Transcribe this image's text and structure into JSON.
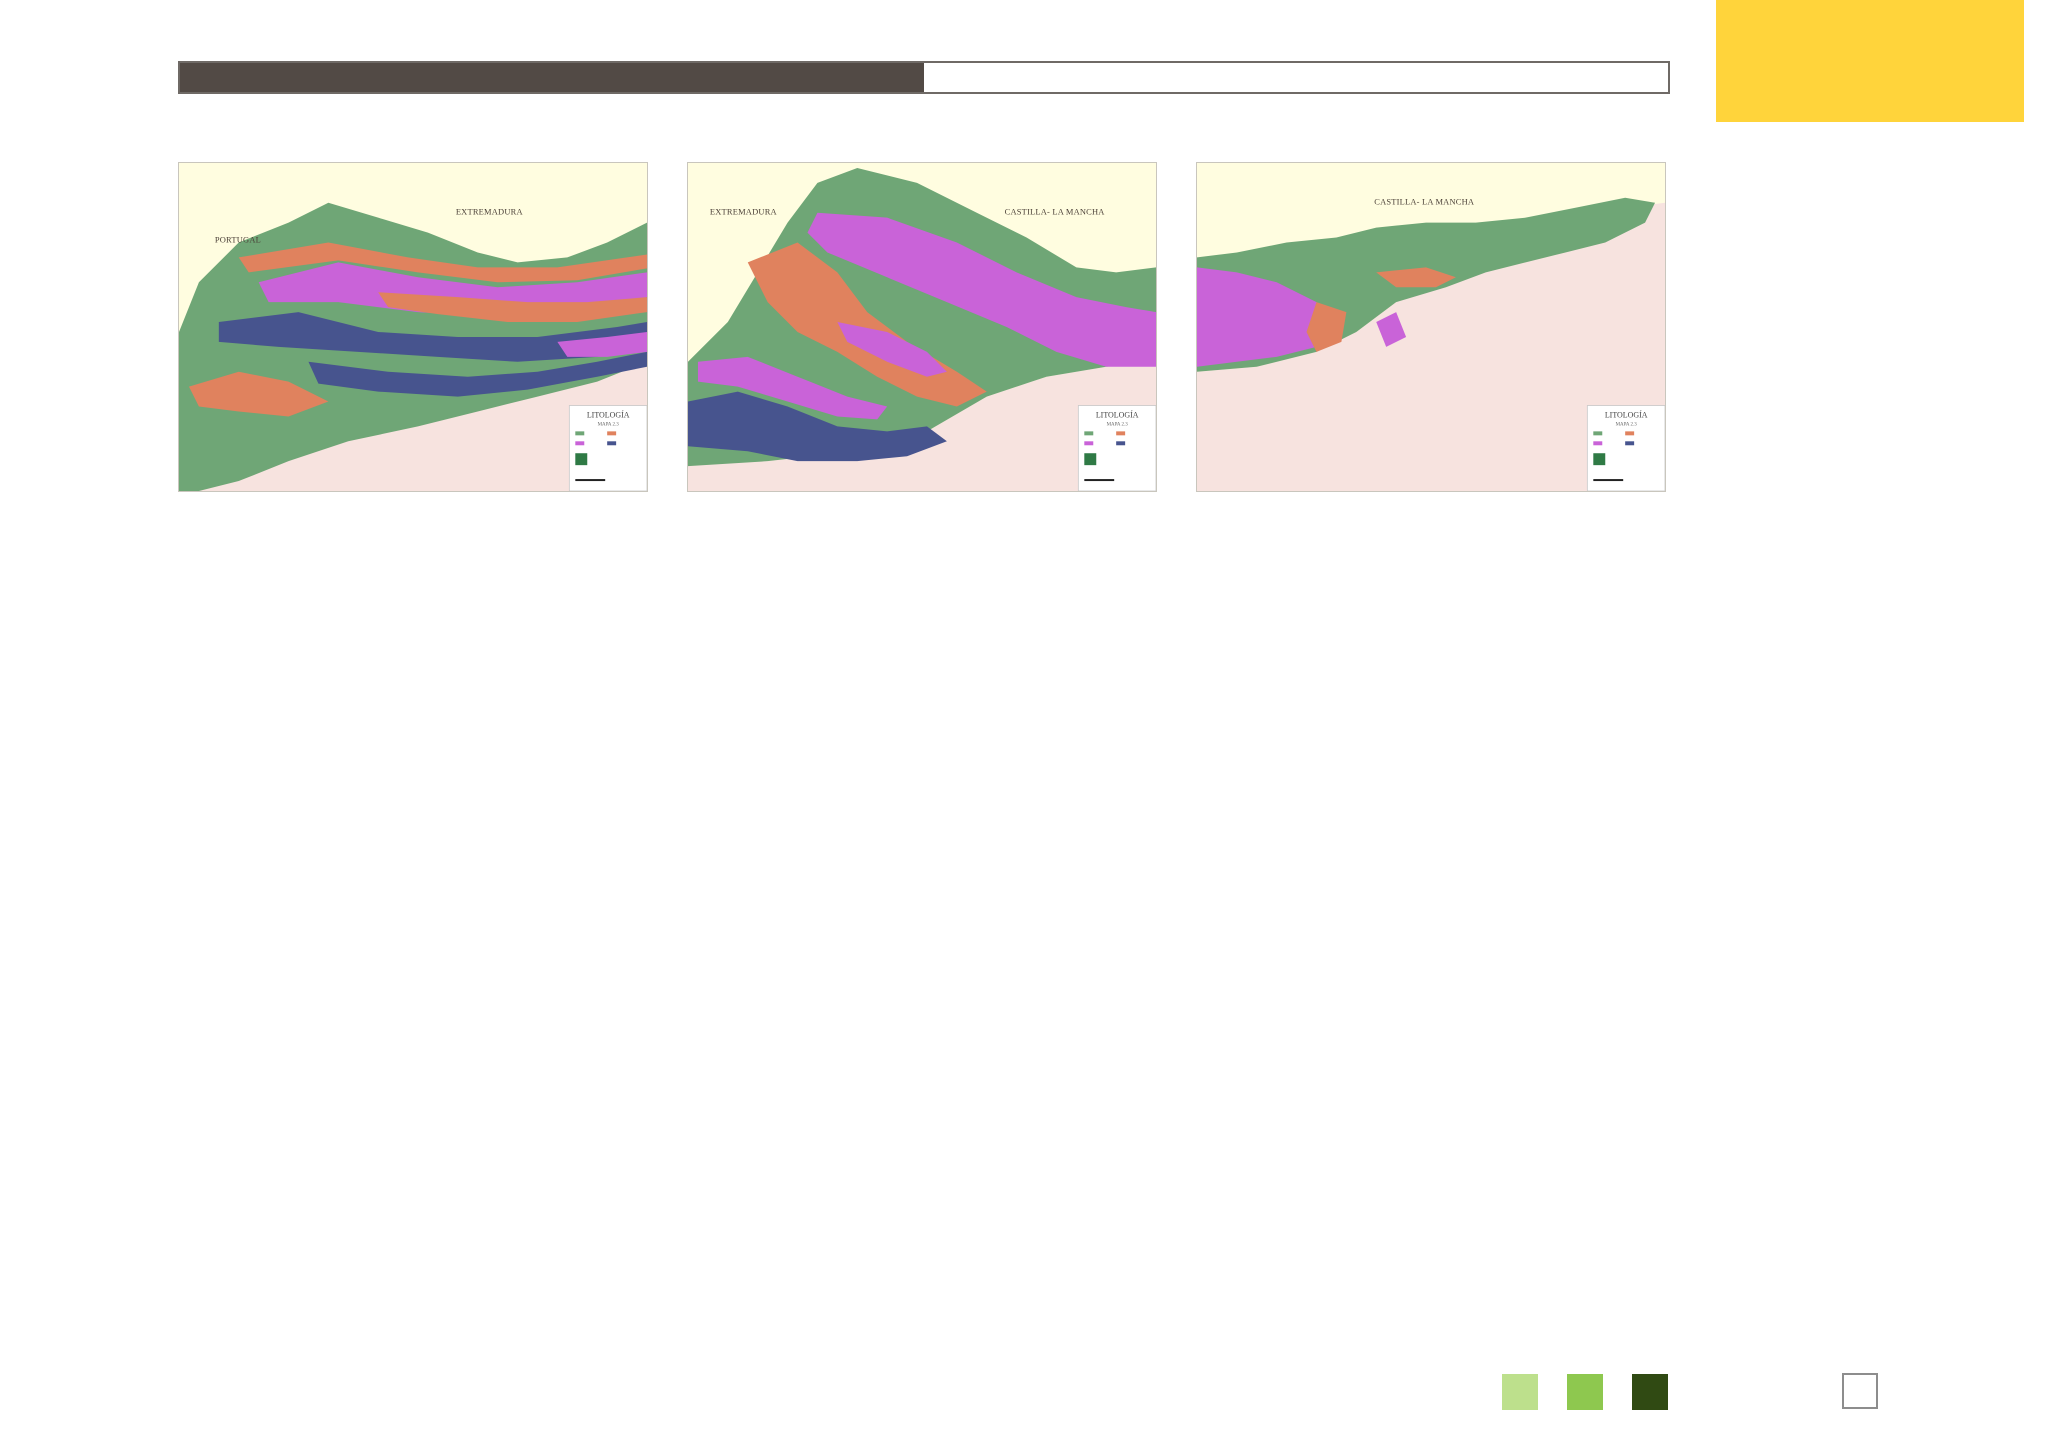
{
  "header": {
    "progress": 0.5
  },
  "maps": [
    {
      "id": "west",
      "labels": [
        "EXTREMADURA",
        "PORTUGAL"
      ],
      "legend_title": "LITOLOGÍA",
      "legend_sub": "MAPA 2.3"
    },
    {
      "id": "center",
      "labels": [
        "EXTREMADURA",
        "CASTILLA- LA MANCHA"
      ],
      "legend_title": "LITOLOGÍA",
      "legend_sub": "MAPA 2.3"
    },
    {
      "id": "east",
      "labels": [
        "CASTILLA- LA MANCHA"
      ],
      "legend_title": "LITOLOGÍA",
      "legend_sub": "MAPA 2.3"
    }
  ],
  "footer": {
    "swatches": [
      "#bde08c",
      "#8ec84f",
      "#304a13"
    ],
    "page_box": ""
  },
  "colors": {
    "accent": "#ffd43b",
    "header_dark": "#524a45",
    "outside_area": "#fffde0",
    "lowland": "#f7e3df",
    "litho_green": "#6fa676",
    "litho_orange": "#e0825e",
    "litho_magenta": "#c963d8",
    "litho_blue": "#47548e"
  }
}
